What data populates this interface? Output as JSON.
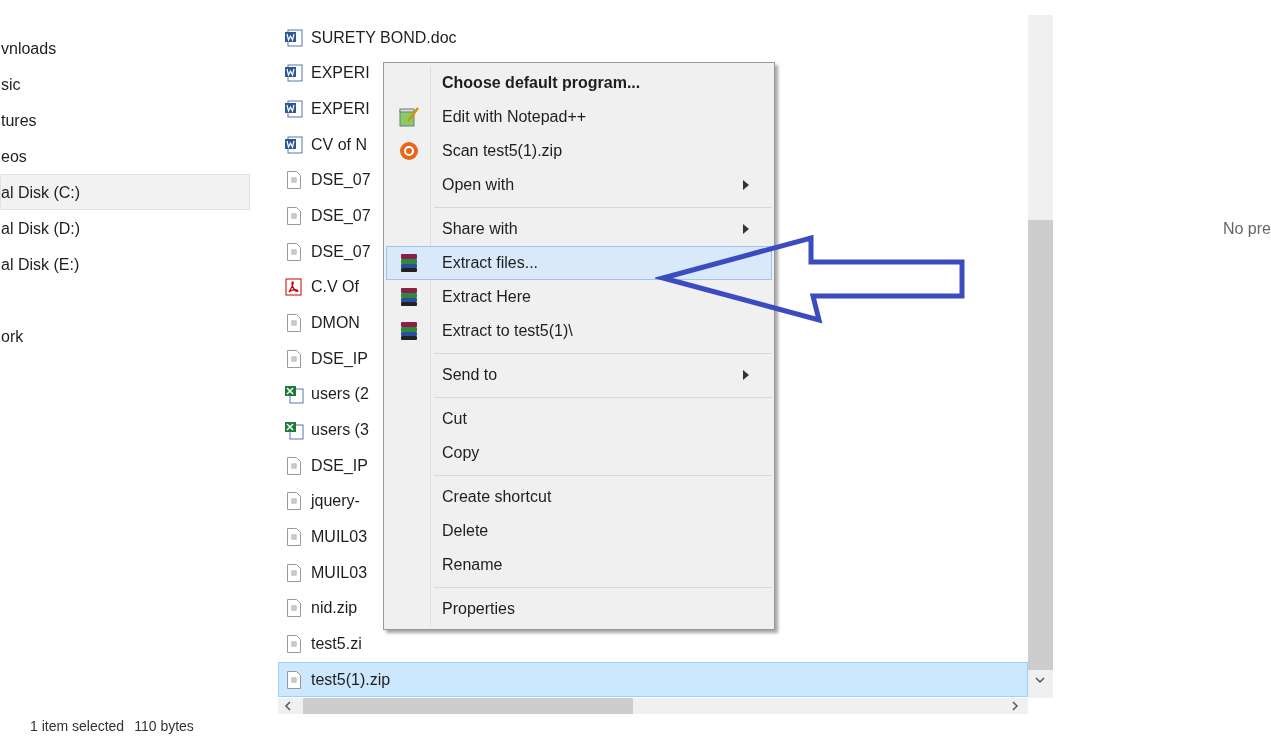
{
  "navigation": {
    "groups": [
      {
        "items": [
          {
            "label": "vnloads",
            "selected": false
          },
          {
            "label": "sic",
            "selected": false
          },
          {
            "label": "tures",
            "selected": false
          },
          {
            "label": "eos",
            "selected": false
          },
          {
            "label": "al Disk (C:)",
            "selected": true
          },
          {
            "label": "al Disk (D:)",
            "selected": false
          },
          {
            "label": "al Disk (E:)",
            "selected": false
          }
        ]
      },
      {
        "items": [
          {
            "label": "ork",
            "selected": false
          }
        ]
      }
    ]
  },
  "files": [
    {
      "name": "SURETY BOND.doc",
      "kind": "word",
      "selected": false
    },
    {
      "name": "EXPERI",
      "kind": "word",
      "selected": false
    },
    {
      "name": "EXPERI",
      "kind": "word",
      "selected": false
    },
    {
      "name": "CV of N",
      "kind": "word",
      "selected": false
    },
    {
      "name": "DSE_07",
      "kind": "generic",
      "selected": false
    },
    {
      "name": "DSE_07",
      "kind": "generic",
      "selected": false
    },
    {
      "name": "DSE_07",
      "kind": "generic",
      "selected": false
    },
    {
      "name": "C.V Of",
      "kind": "pdf",
      "selected": false
    },
    {
      "name": "DMON",
      "kind": "generic",
      "selected": false
    },
    {
      "name": "DSE_IP",
      "kind": "generic",
      "selected": false
    },
    {
      "name": "users (2",
      "kind": "excel",
      "selected": false
    },
    {
      "name": "users (3",
      "kind": "excel",
      "selected": false
    },
    {
      "name": "DSE_IP",
      "kind": "generic",
      "selected": false
    },
    {
      "name": "jquery-",
      "kind": "generic",
      "selected": false
    },
    {
      "name": "MUIL03",
      "kind": "generic",
      "selected": false
    },
    {
      "name": "MUIL03",
      "kind": "generic",
      "selected": false
    },
    {
      "name": "nid.zip",
      "kind": "generic",
      "selected": false
    },
    {
      "name": "test5.zi",
      "kind": "generic",
      "selected": false
    },
    {
      "name": "test5(1).zip",
      "kind": "generic",
      "selected": true
    }
  ],
  "context_menu": {
    "items": [
      {
        "kind": "plain",
        "label": "Choose default program...",
        "bold": true,
        "submenu": false,
        "selected": false
      },
      {
        "kind": "notepad",
        "label": "Edit with Notepad++",
        "submenu": false,
        "selected": false
      },
      {
        "kind": "scan",
        "label": "Scan test5(1).zip",
        "submenu": false,
        "selected": false
      },
      {
        "kind": "plain",
        "label": "Open with",
        "submenu": true,
        "selected": false
      },
      {
        "kind": "separator"
      },
      {
        "kind": "plain",
        "label": "Share with",
        "submenu": true,
        "selected": false
      },
      {
        "kind": "archive",
        "label": "Extract files...",
        "submenu": false,
        "selected": true
      },
      {
        "kind": "archive",
        "label": "Extract Here",
        "submenu": false,
        "selected": false
      },
      {
        "kind": "archive",
        "label": "Extract to test5(1)\\",
        "submenu": false,
        "selected": false
      },
      {
        "kind": "separator"
      },
      {
        "kind": "plain",
        "label": "Send to",
        "submenu": true,
        "selected": false
      },
      {
        "kind": "separator"
      },
      {
        "kind": "plain",
        "label": "Cut",
        "submenu": false,
        "selected": false
      },
      {
        "kind": "plain",
        "label": "Copy",
        "submenu": false,
        "selected": false
      },
      {
        "kind": "separator"
      },
      {
        "kind": "plain",
        "label": "Create shortcut",
        "submenu": false,
        "selected": false
      },
      {
        "kind": "plain",
        "label": "Delete",
        "submenu": false,
        "selected": false
      },
      {
        "kind": "plain",
        "label": "Rename",
        "submenu": false,
        "selected": false
      },
      {
        "kind": "separator"
      },
      {
        "kind": "plain",
        "label": "Properties",
        "submenu": false,
        "selected": false
      }
    ]
  },
  "preview": {
    "message": "No pre"
  },
  "status_bar": {
    "selection": "1 item selected",
    "size": "110 bytes"
  }
}
